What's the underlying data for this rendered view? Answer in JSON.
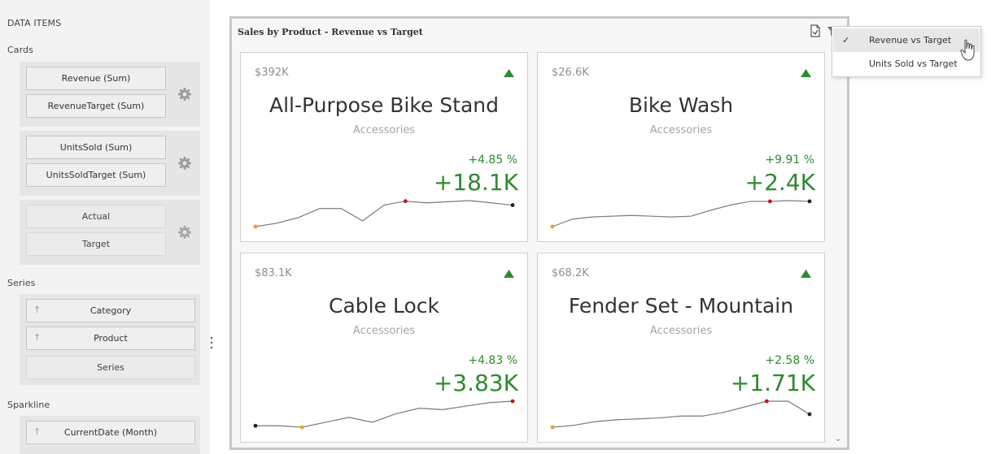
{
  "data_items": {
    "title": "DATA ITEMS",
    "cards_label": "Cards",
    "card_groups": [
      {
        "actual": "Revenue (Sum)",
        "target": "RevenueTarget (Sum)"
      },
      {
        "actual": "UnitsSold (Sum)",
        "target": "UnitsSoldTarget (Sum)"
      },
      {
        "actual": "Actual",
        "target": "Target"
      }
    ],
    "series_label": "Series",
    "series_items": [
      "Category",
      "Product"
    ],
    "series_placeholder": "Series",
    "sparkline_label": "Sparkline",
    "sparkline_item": "CurrentDate (Month)"
  },
  "dashboard": {
    "title": "Sales by Product - Revenue vs Target",
    "icons": [
      "export-icon",
      "filter-icon"
    ],
    "cards": [
      {
        "amount": "$392K",
        "product": "All-Purpose Bike Stand",
        "category": "Accessories",
        "percent": "+4.85 %",
        "delta": "+18.1K",
        "trend": "up",
        "spark": [
          0,
          6,
          16,
          32,
          32,
          10,
          38,
          45,
          42,
          44,
          46,
          42,
          38
        ],
        "spark_start": 0,
        "spark_high": 7,
        "spark_end": 12
      },
      {
        "amount": "$26.6K",
        "product": "Bike Wash",
        "category": "Accessories",
        "percent": "+9.91 %",
        "delta": "+2.4K",
        "trend": "up",
        "spark": [
          0,
          10,
          13,
          14,
          15,
          14,
          13,
          14,
          22,
          29,
          34,
          34,
          35,
          34
        ],
        "spark_start": 0,
        "spark_high": 11,
        "spark_end": 13
      },
      {
        "amount": "$83.1K",
        "product": "Cable Lock",
        "category": "Accessories",
        "percent": "+4.83 %",
        "delta": "+3.83K",
        "trend": "up",
        "spark": [
          5,
          5,
          3,
          10,
          17,
          10,
          22,
          30,
          28,
          33,
          38,
          40
        ],
        "spark_start": 0,
        "spark_low": 2,
        "spark_end": 11
      },
      {
        "amount": "$68.2K",
        "product": "Fender Set - Mountain",
        "category": "Accessories",
        "percent": "+2.58 %",
        "delta": "+1.71K",
        "trend": "up",
        "spark": [
          0,
          2,
          6,
          8,
          9,
          10,
          12,
          12,
          16,
          22,
          28,
          28,
          14
        ],
        "spark_start": 0,
        "spark_high": 10,
        "spark_end": 12
      }
    ]
  },
  "menu": {
    "items": [
      {
        "label": "Revenue vs Target",
        "checked": true,
        "check_mark": "✓"
      },
      {
        "label": "Units Sold vs Target",
        "checked": false
      }
    ]
  },
  "colors": {
    "positive": "#2f8a2f",
    "trend_icon": "#2f8a2f",
    "spark_line": "#7a7a7a",
    "start_point": "#f0a020",
    "high_point": "#c0161b",
    "end_point": "#222222"
  }
}
